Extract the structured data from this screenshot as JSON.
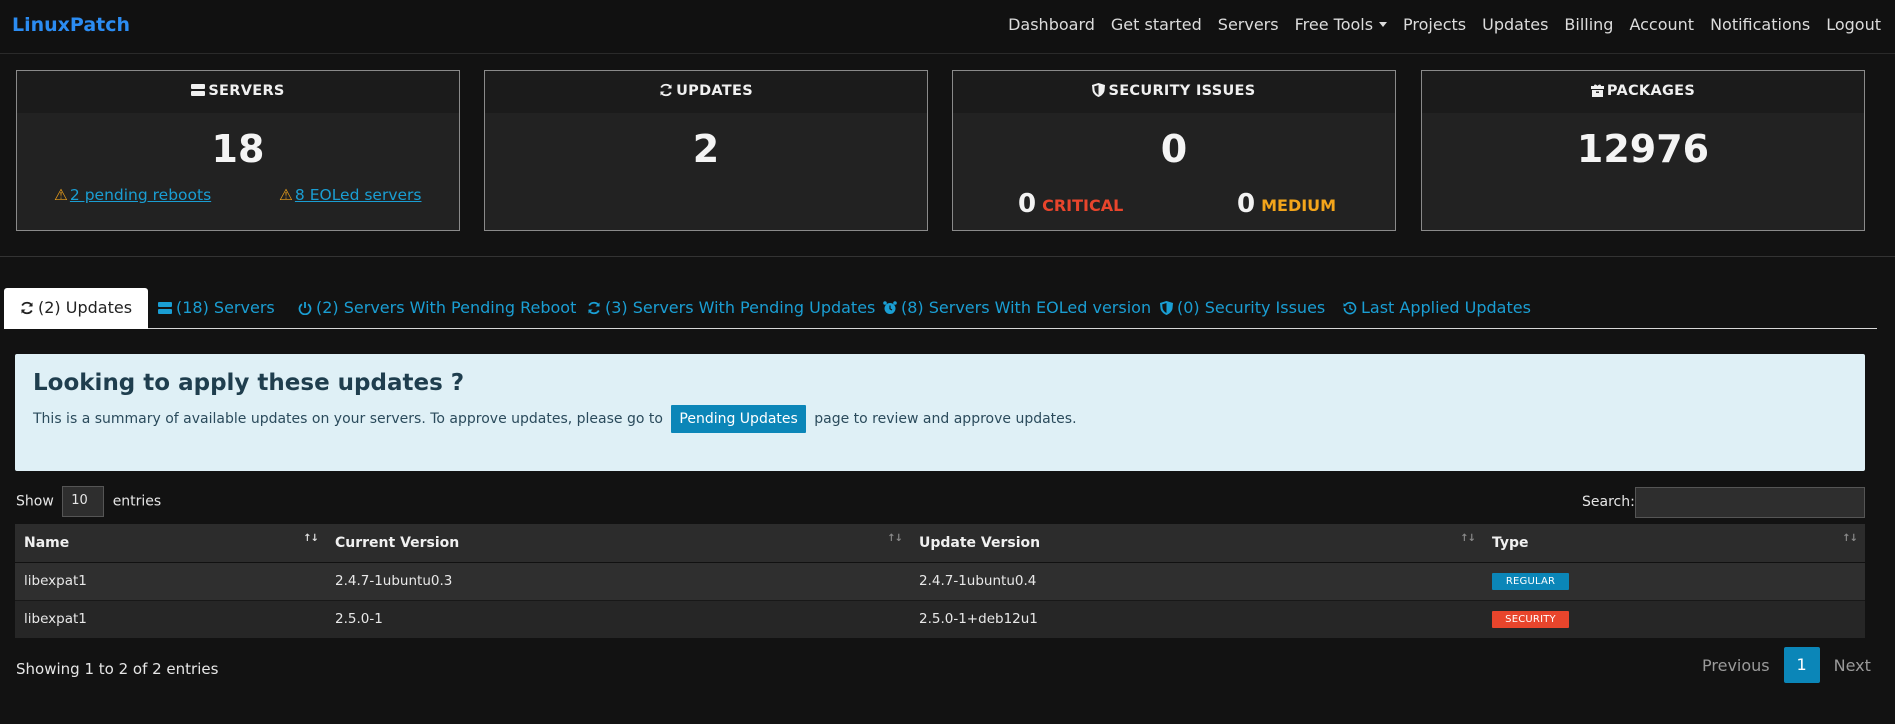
{
  "brand": "LinuxPatch",
  "nav": [
    "Dashboard",
    "Get started",
    "Servers",
    "Free Tools",
    "Projects",
    "Updates",
    "Billing",
    "Account",
    "Notifications",
    "Logout"
  ],
  "cards": {
    "servers": {
      "title": "SERVERS",
      "value": "18",
      "reboots": "2 pending reboots",
      "eol": "8 EOLed servers"
    },
    "updates": {
      "title": "UPDATES",
      "value": "2"
    },
    "security": {
      "title": "SECURITY ISSUES",
      "value": "0",
      "critical_count": "0",
      "critical_label": "CRITICAL",
      "medium_count": "0",
      "medium_label": "MEDIUM"
    },
    "packages": {
      "title": "PACKAGES",
      "value": "12976"
    }
  },
  "tabs": [
    "(2) Updates",
    "(18) Servers",
    "(2) Servers With Pending Reboot",
    "(3) Servers With Pending Updates",
    "(8) Servers With EOLed version",
    "(0) Security Issues",
    "Last Applied Updates"
  ],
  "alert": {
    "title": "Looking to apply these updates ?",
    "text_before": "This is a summary of available updates on your servers. To approve updates, please go to",
    "button": "Pending Updates",
    "text_after": "page to review and approve updates."
  },
  "table": {
    "show_label": "Show",
    "entries_value": "10",
    "entries_label": "entries",
    "search_label": "Search:",
    "columns": [
      "Name",
      "Current Version",
      "Update Version",
      "Type"
    ],
    "rows": [
      {
        "name": "libexpat1",
        "current": "2.4.7-1ubuntu0.3",
        "update": "2.4.7-1ubuntu0.4",
        "type": "REGULAR"
      },
      {
        "name": "libexpat1",
        "current": "2.5.0-1",
        "update": "2.5.0-1+deb12u1",
        "type": "SECURITY"
      }
    ],
    "info": "Showing 1 to 2 of 2 entries",
    "pagination": {
      "previous": "Previous",
      "page": "1",
      "next": "Next"
    }
  },
  "colors": {
    "link": "#1a9ed3",
    "brand": "#2b8cf2",
    "critical": "#e8452c",
    "medium": "#f3a51b",
    "badge_regular": "#0b86b8",
    "badge_security": "#e8452c"
  }
}
